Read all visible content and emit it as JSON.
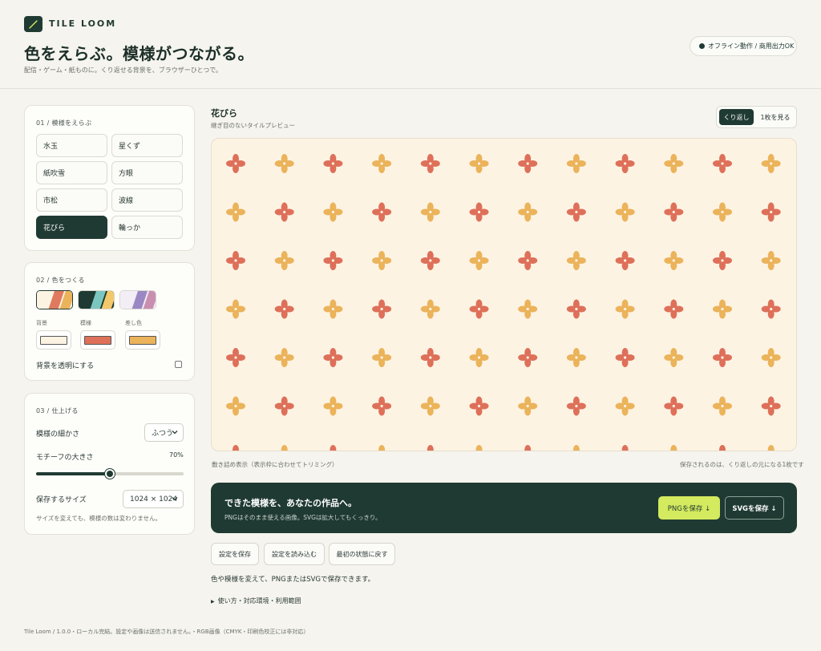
{
  "header": {
    "brand": "TILE LOOM",
    "title": "色をえらぶ。模様がつながる。",
    "subtitle": "配信・ゲーム・紙ものに。くり返せる背景を、ブラウザーひとつで。",
    "status": "オフライン動作 / 商用出力OK",
    "logo_icon": "brush-icon"
  },
  "step1": {
    "label": "01 / 模様をえらぶ",
    "patterns": [
      {
        "label": "水玉"
      },
      {
        "label": "星くず"
      },
      {
        "label": "紙吹雪"
      },
      {
        "label": "方眼"
      },
      {
        "label": "市松"
      },
      {
        "label": "波線"
      },
      {
        "label": "花びら",
        "active": true
      },
      {
        "label": "輪っか"
      }
    ]
  },
  "step2": {
    "label": "02 / 色をつくる",
    "palettes": [
      {
        "colors": [
          "#fdf3e3",
          "#e07a5f",
          "#ebb35a"
        ],
        "selected": true
      },
      {
        "colors": [
          "#1f3a32",
          "#7cc6c0",
          "#f2c86a"
        ]
      },
      {
        "colors": [
          "#f3eef6",
          "#9b87c4",
          "#c98fb0"
        ]
      }
    ],
    "swatches": [
      {
        "label": "背景",
        "color": "#fdf3e3"
      },
      {
        "label": "模様",
        "color": "#de705a"
      },
      {
        "label": "差し色",
        "color": "#ebb35a"
      }
    ],
    "transparent_label": "背景を透明にする",
    "transparent_checked": false
  },
  "step3": {
    "label": "03 / 仕上げる",
    "density_label": "模様の細かさ",
    "density_value": "ふつう",
    "size_label": "モチーフの大きさ",
    "size_value": "70%",
    "size_fraction": 0.5,
    "export_label": "保存するサイズ",
    "export_value": "1024 × 1024",
    "note": "サイズを変えても、模様の数は変わりません。"
  },
  "preview": {
    "title": "花びら",
    "subtitle": "継ぎ目のないタイルプレビュー",
    "toggle_on": "くり返し",
    "toggle_off": "1枚を見る",
    "caption_left": "敷き詰め表示（表示枠に合わせてトリミング）",
    "caption_right": "保存されるのは、くり返しの元になる1枚です",
    "bg_color": "#fdf3e3",
    "color_a": "#de705a",
    "color_b": "#ebb35a"
  },
  "cta": {
    "title": "できた模様を、あなたの作品へ。",
    "subtitle": "PNGはそのまま使える画像。SVGは拡大してもくっきり。",
    "png_label": "PNGを保存 ↓",
    "svg_label": "SVGを保存 ↓"
  },
  "actions": {
    "save": "設定を保存",
    "load": "設定を読み込む",
    "reset": "最初の状態に戻す"
  },
  "helper": "色や模様を変えて、PNGまたはSVGで保存できます。",
  "details": "使い方・対応環境・利用範囲",
  "footer": "Tile Loom / 1.0.0・ローカル完結。設定や画像は送信されません。・RGB画像（CMYK・印刷色校正には非対応）"
}
